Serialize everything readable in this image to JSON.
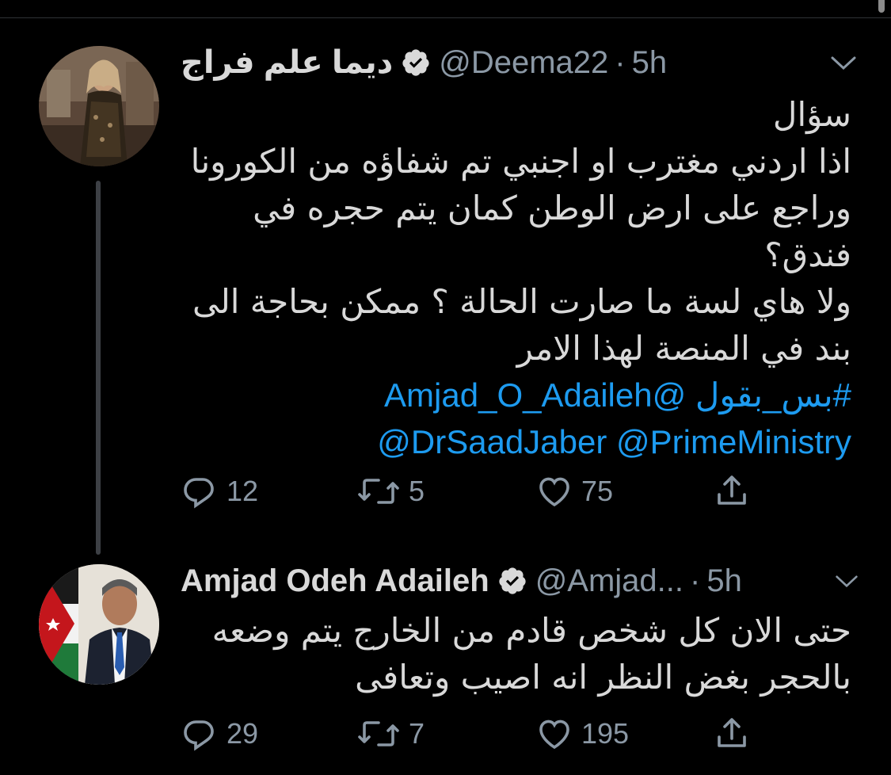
{
  "tweets": [
    {
      "name": "ديما علم فراج",
      "handle": "@Deema22",
      "time": "5h",
      "lines": [
        "سؤال",
        "اذا اردني مغترب او اجنبي تم شفاؤه من الكورونا",
        "وراجع على ارض الوطن كمان يتم حجره في",
        "فندق؟",
        "ولا هاي لسة ما صارت الحالة ؟ ممكن بحاجة الى",
        "بند في المنصة لهذا الامر"
      ],
      "link_lines": [
        "#بس_بقول @Amjad_O_Adaileh",
        "@DrSaadJaber @PrimeMinistry"
      ],
      "replies": "12",
      "retweets": "5",
      "likes": "75"
    },
    {
      "name": "Amjad Odeh Adaileh",
      "handle": "@Amjad...",
      "time": "5h",
      "lines": [
        "حتى الان كل شخص قادم من الخارج يتم وضعه",
        "بالحجر بغض النظر انه اصيب وتعافى"
      ],
      "replies": "29",
      "retweets": "7",
      "likes": "195"
    }
  ],
  "colors": {
    "background": "#000000",
    "text": "#d9d9d9",
    "secondary": "#8b98a5",
    "link": "#1d9bf0"
  },
  "icons": [
    "chevron-down-icon",
    "verified-icon",
    "reply-icon",
    "retweet-icon",
    "like-icon",
    "share-icon"
  ]
}
